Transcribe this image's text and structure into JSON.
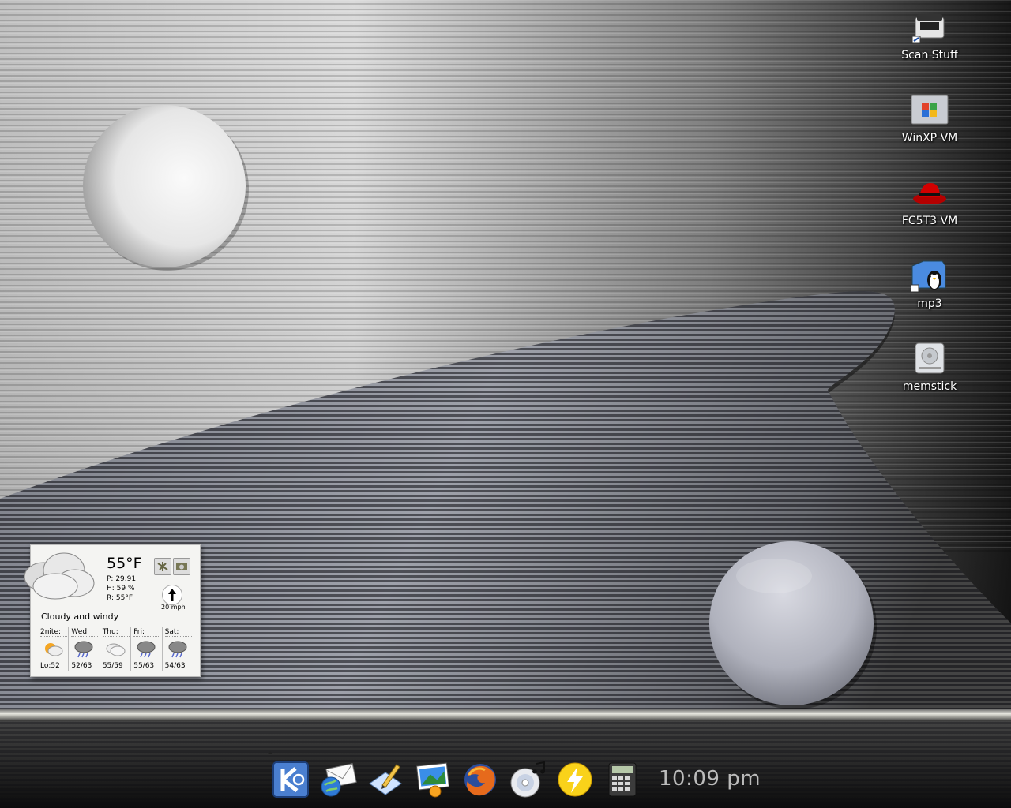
{
  "desktop": {
    "icons": [
      {
        "label": "Scan Stuff",
        "icon": "scanner-icon"
      },
      {
        "label": "WinXP VM",
        "icon": "windows-vm-icon"
      },
      {
        "label": "FC5T3 VM",
        "icon": "redhat-hat-icon"
      },
      {
        "label": "mp3",
        "icon": "folder-penguin-icon"
      },
      {
        "label": "memstick",
        "icon": "removable-drive-icon"
      }
    ]
  },
  "weather": {
    "temperature": "55°F",
    "pressure": "P:  29.91",
    "humidity": "H:  59 %",
    "real_feel": "R:  55°F",
    "wind_speed": "20 mph",
    "condition": "Cloudy and windy",
    "forecast": [
      {
        "day": "2nite:",
        "range": "Lo:52",
        "icon": "partly-cloudy-night-icon"
      },
      {
        "day": "Wed:",
        "range": "52/63",
        "icon": "rain-cloud-icon"
      },
      {
        "day": "Thu:",
        "range": "55/59",
        "icon": "cloudy-icon"
      },
      {
        "day": "Fri:",
        "range": "55/63",
        "icon": "rain-cloud-icon"
      },
      {
        "day": "Sat:",
        "range": "54/63",
        "icon": "rain-cloud-icon"
      }
    ]
  },
  "taskbar": {
    "launchers": [
      {
        "name": "kde-menu-icon"
      },
      {
        "name": "mail-globe-icon"
      },
      {
        "name": "text-editor-icon"
      },
      {
        "name": "image-viewer-icon"
      },
      {
        "name": "firefox-icon"
      },
      {
        "name": "cd-music-icon"
      },
      {
        "name": "lightning-icon"
      },
      {
        "name": "calculator-icon"
      }
    ],
    "clock": "10:09 pm"
  },
  "colors": {
    "wallpaper_light": "#d8d8d8",
    "wallpaper_dark": "#1a1a1a",
    "clock_text": "#bbbbbb"
  }
}
